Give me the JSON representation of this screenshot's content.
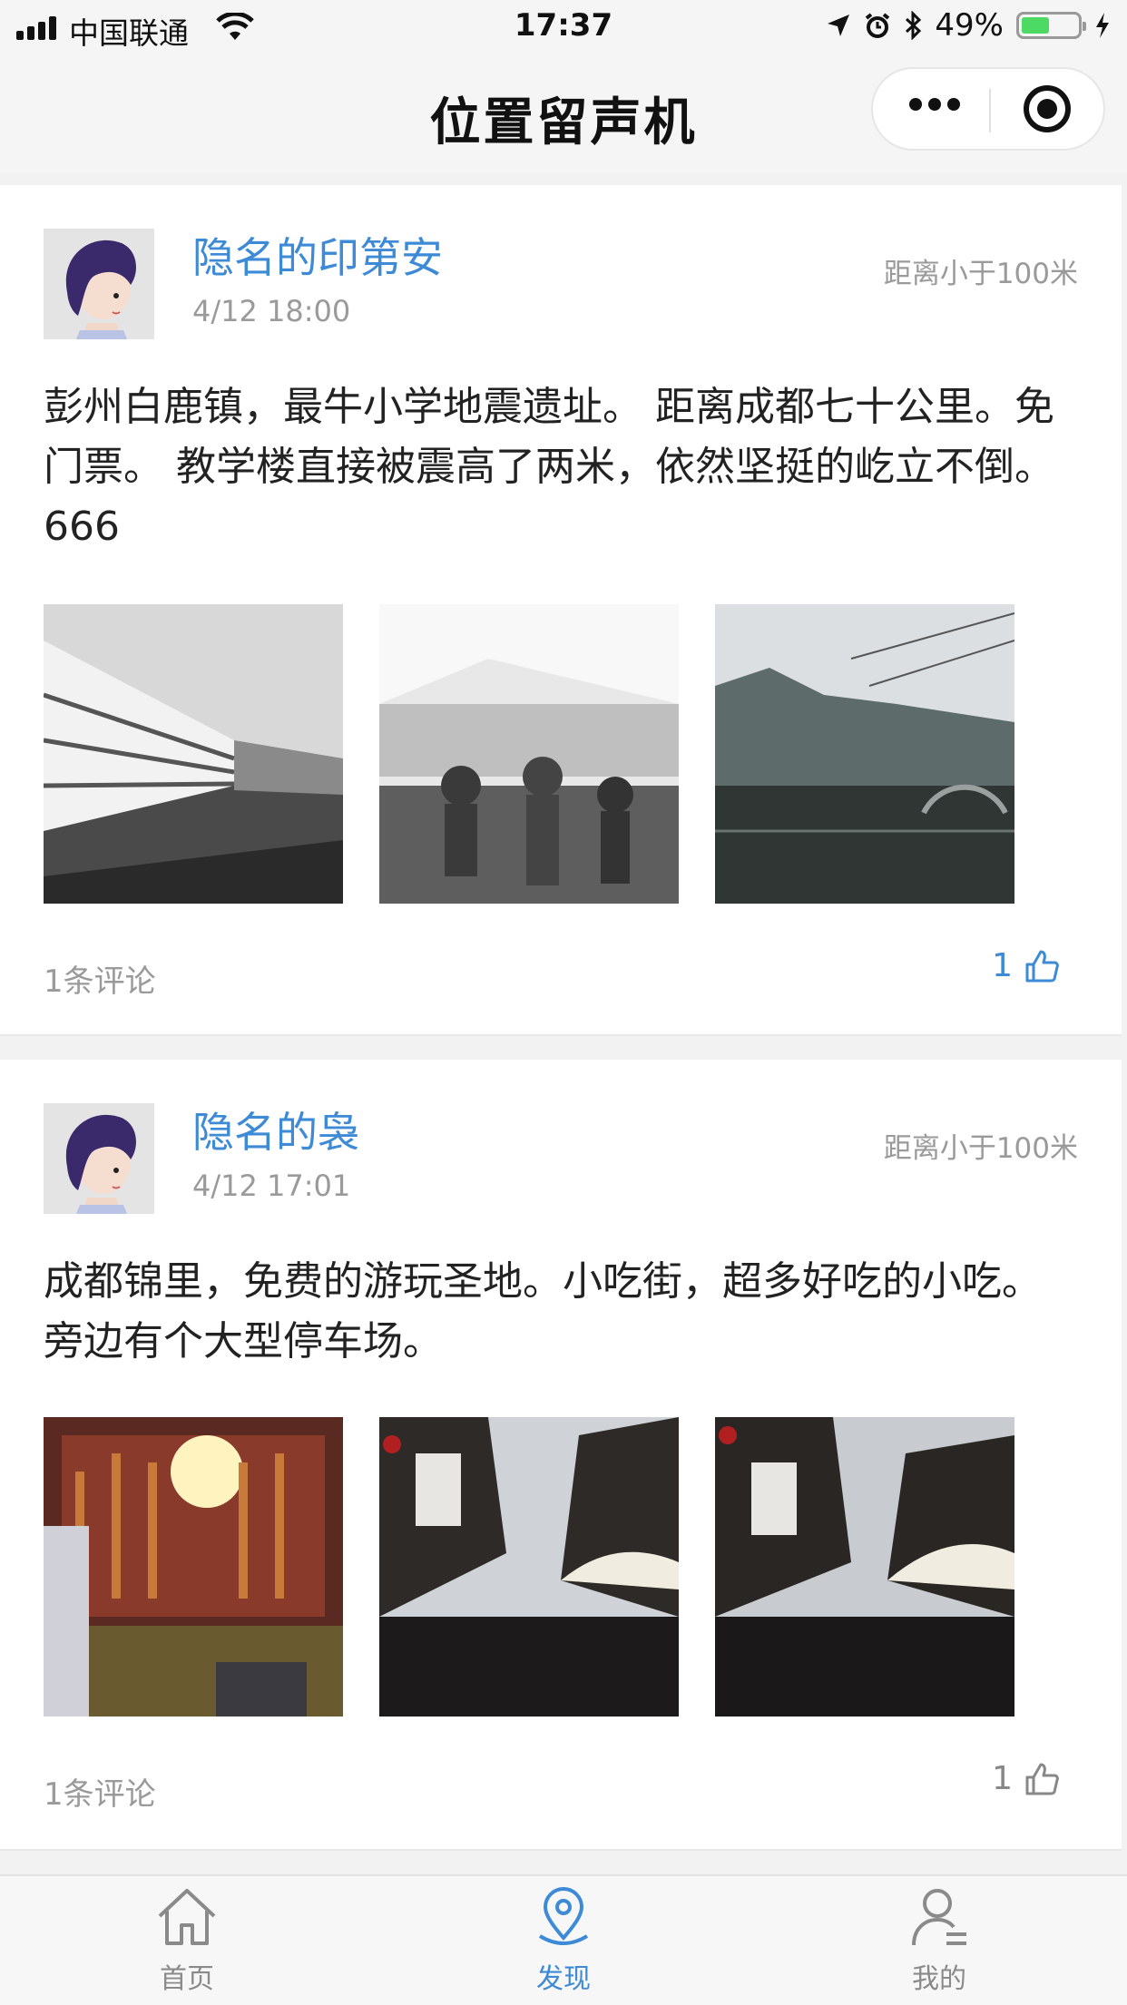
{
  "status_bar": {
    "carrier": "中国联通",
    "time": "17:37",
    "battery": "49%",
    "battery_level": 0.49
  },
  "navbar": {
    "title": "位置留声机"
  },
  "posts": [
    {
      "user": "隐名的印第安",
      "time": "4/12 18:00",
      "distance": "距离小于100米",
      "content": "彭州白鹿镇，最牛小学地震遗址。 距离成都七十公里。免门票。 教学楼直接被震高了两米，依然坚挺的屹立不倒。666",
      "comments": "1条评论",
      "likes": "1"
    },
    {
      "user": "隐名的袅",
      "time": "4/12 17:01",
      "distance": "距离小于100米",
      "content": "成都锦里，免费的游玩圣地。小吃街，超多好吃的小吃。旁边有个大型停车场。",
      "comments": "1条评论",
      "likes": "1"
    }
  ],
  "tabbar": {
    "tabs": [
      {
        "label": "首页",
        "icon": "home-icon",
        "active": false
      },
      {
        "label": "发现",
        "icon": "location-pin-icon",
        "active": true
      },
      {
        "label": "我的",
        "icon": "user-icon",
        "active": false
      }
    ]
  },
  "colors": {
    "accent": "#3d8ad6",
    "muted_text": "#9a9a9a",
    "background": "#f2f2f2",
    "tab_inactive": "#8a8a8a"
  }
}
